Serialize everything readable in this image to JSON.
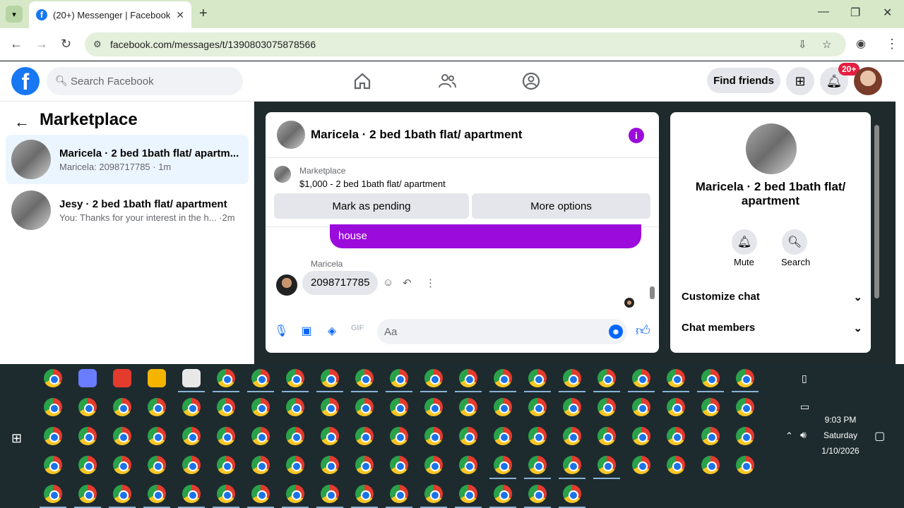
{
  "browser": {
    "tab_title": "(20+) Messenger | Facebook",
    "url": "facebook.com/messages/t/1390803075878566"
  },
  "fb": {
    "search_placeholder": "Search Facebook",
    "find_friends": "Find friends",
    "notif_badge": "20+"
  },
  "left": {
    "title": "Marketplace",
    "threads": [
      {
        "name": "Maricela · 2 bed 1bath flat/ apartm...",
        "preview": "Maricela: 2098717785 · 1m"
      },
      {
        "name": "Jesy · 2 bed 1bath flat/ apartment",
        "preview": "You: Thanks for your interest in the h... ·2m"
      }
    ]
  },
  "chat": {
    "title": "Maricela · 2 bed 1bath flat/ apartment",
    "marketplace_label": "Marketplace",
    "listing": "$1,000 - 2 bed 1bath flat/ apartment",
    "mark_pending": "Mark as pending",
    "more_options": "More options",
    "outgoing_tail": "house",
    "sender": "Maricela",
    "incoming": "2098717785",
    "composer_placeholder": "Aa"
  },
  "right": {
    "title": "Maricela · 2 bed 1bath flat/ apartment",
    "mute": "Mute",
    "search": "Search",
    "customize": "Customize chat",
    "members": "Chat members"
  },
  "taskbar": {
    "time": "9:03 PM",
    "day": "Saturday",
    "date": "1/10/2026"
  }
}
